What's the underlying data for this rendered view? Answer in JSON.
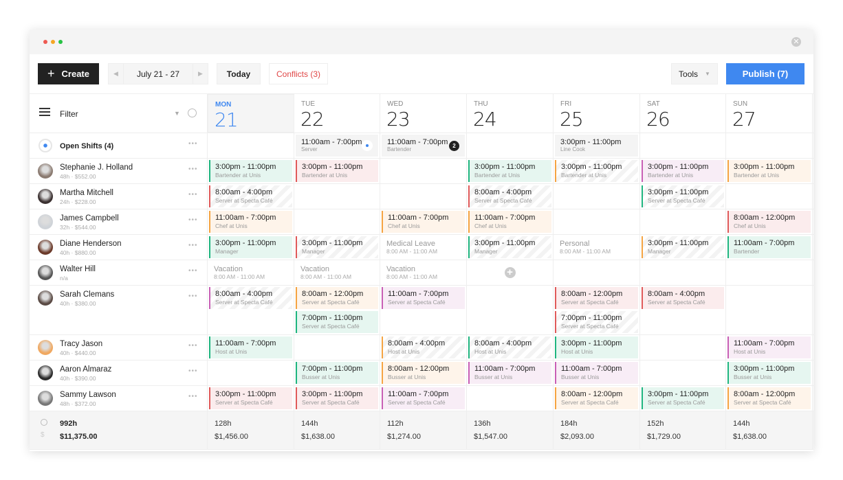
{
  "window": {
    "close_icon": "close-icon",
    "dots": [
      "#ee5a52",
      "#f5a623",
      "#27c245"
    ]
  },
  "toolbar": {
    "create_label": "Create",
    "date_range": "July 21 - 27",
    "today_label": "Today",
    "conflicts_label": "Conflicts (3)",
    "tools_label": "Tools",
    "publish_label": "Publish (7)"
  },
  "colors": {
    "accent": "#3f88f0",
    "conflict": "#e04646",
    "green": "#1fb57f",
    "red": "#e05a5a",
    "orange": "#f5a442",
    "pink": "#c85fb5"
  },
  "filter": {
    "label": "Filter"
  },
  "days": [
    {
      "name": "MON",
      "date": "21",
      "today": true
    },
    {
      "name": "TUE",
      "date": "22"
    },
    {
      "name": "WED",
      "date": "23"
    },
    {
      "name": "THU",
      "date": "24"
    },
    {
      "name": "FRI",
      "date": "25"
    },
    {
      "name": "SAT",
      "date": "26"
    },
    {
      "name": "SUN",
      "date": "27"
    }
  ],
  "open_shifts": {
    "label": "Open Shifts (4)",
    "days": [
      null,
      {
        "time": "11:00am - 7:00pm",
        "role": "Server",
        "marker": "dot"
      },
      {
        "time": "11:00am - 7:00pm",
        "role": "Bartender",
        "badge": "2"
      },
      null,
      {
        "time": "3:00pm - 11:00pm",
        "role": "Line Cook"
      },
      null,
      null
    ]
  },
  "employees": [
    {
      "name": "Stephanie J. Holland",
      "meta": "48h · $552.00",
      "days": [
        [
          {
            "time": "3:00pm - 11:00pm",
            "role": "Bartender at Unis",
            "color": "green"
          }
        ],
        [
          {
            "time": "3:00pm - 11:00pm",
            "role": "Bartender at Unis",
            "color": "red"
          }
        ],
        [],
        [
          {
            "time": "3:00pm - 11:00pm",
            "role": "Bartender at Unis",
            "color": "green"
          }
        ],
        [
          {
            "time": "3:00pm - 11:00pm",
            "role": "Bartender at Unis",
            "color": "orange",
            "striped": true
          }
        ],
        [
          {
            "time": "3:00pm - 11:00pm",
            "role": "Bartender at Unis",
            "color": "pink"
          }
        ],
        [
          {
            "time": "3:00pm - 11:00pm",
            "role": "Bartender at Unis",
            "color": "orange"
          }
        ]
      ]
    },
    {
      "name": "Martha Mitchell",
      "meta": "24h · $228.00",
      "days": [
        [
          {
            "time": "8:00am - 4:00pm",
            "role": "Server at Specta Café",
            "color": "red",
            "striped": true
          }
        ],
        [],
        [],
        [
          {
            "time": "8:00am - 4:00pm",
            "role": "Server at Specta Café",
            "color": "red",
            "striped": true
          }
        ],
        [],
        [
          {
            "time": "3:00pm - 11:00pm",
            "role": "Server at Specta Café",
            "color": "green",
            "striped": true
          }
        ],
        []
      ]
    },
    {
      "name": "James Campbell",
      "meta": "32h · $544.00",
      "days": [
        [
          {
            "time": "11:00am - 7:00pm",
            "role": "Chef at Unis",
            "color": "orange"
          }
        ],
        [],
        [
          {
            "time": "11:00am - 7:00pm",
            "role": "Chef at Unis",
            "color": "orange"
          }
        ],
        [
          {
            "time": "11:00am - 7:00pm",
            "role": "Chef at Unis",
            "color": "orange"
          }
        ],
        [],
        [],
        [
          {
            "time": "8:00am - 12:00pm",
            "role": "Chef at Unis",
            "color": "red"
          }
        ]
      ]
    },
    {
      "name": "Diane Henderson",
      "meta": "40h · $880.00",
      "days": [
        [
          {
            "time": "3:00pm - 11:00pm",
            "role": "Manager",
            "color": "green"
          }
        ],
        [
          {
            "time": "3:00pm - 11:00pm",
            "role": "Manager",
            "color": "red",
            "striped": true
          }
        ],
        [
          {
            "leave": "Medical Leave",
            "time": "8:00 AM - 11:00 AM"
          }
        ],
        [
          {
            "time": "3:00pm - 11:00pm",
            "role": "Manager",
            "color": "green",
            "striped": true
          }
        ],
        [
          {
            "leave": "Personal",
            "time": "8:00 AM - 11:00 AM"
          }
        ],
        [
          {
            "time": "3:00pm - 11:00pm",
            "role": "Manager",
            "color": "orange",
            "striped": true
          }
        ],
        [
          {
            "time": "11:00am - 7:00pm",
            "role": "Bartender",
            "color": "green"
          }
        ]
      ]
    },
    {
      "name": "Walter Hill",
      "meta": "n/a",
      "days": [
        [
          {
            "leave": "Vacation",
            "time": "8:00 AM - 11:00 AM"
          }
        ],
        [
          {
            "leave": "Vacation",
            "time": "8:00 AM - 11:00 AM"
          }
        ],
        [
          {
            "leave": "Vacation",
            "time": "8:00 AM - 11:00 AM"
          }
        ],
        [
          {
            "add": true
          }
        ],
        [],
        [],
        []
      ]
    },
    {
      "name": "Sarah Clemans",
      "meta": "40h · $380.00",
      "tall": true,
      "days": [
        [
          {
            "time": "8:00am - 4:00pm",
            "role": "Server at Specta Café",
            "color": "pink",
            "striped": true
          }
        ],
        [
          {
            "time": "8:00am - 12:00pm",
            "role": "Server at Specta Café",
            "color": "orange"
          },
          {
            "time": "7:00pm - 11:00pm",
            "role": "Server at Specta Café",
            "color": "green"
          }
        ],
        [
          {
            "time": "11:00am - 7:00pm",
            "role": "Server at Specta Café",
            "color": "pink"
          }
        ],
        [],
        [
          {
            "time": "8:00am - 12:00pm",
            "role": "Server at Specta Café",
            "color": "red"
          },
          {
            "time": "7:00pm - 11:00pm",
            "role": "Server at Specta Café",
            "color": "red",
            "striped": true
          }
        ],
        [
          {
            "time": "8:00am - 4:00pm",
            "role": "Server at Specta Café",
            "color": "red"
          }
        ],
        []
      ]
    },
    {
      "name": "Tracy Jason",
      "meta": "40h · $440.00",
      "days": [
        [
          {
            "time": "11:00am - 7:00pm",
            "role": "Host at Unis",
            "color": "green"
          }
        ],
        [],
        [
          {
            "time": "8:00am - 4:00pm",
            "role": "Host at Unis",
            "color": "orange",
            "striped": true
          }
        ],
        [
          {
            "time": "8:00am - 4:00pm",
            "role": "Host at Unis",
            "color": "green",
            "striped": true
          }
        ],
        [
          {
            "time": "3:00pm - 11:00pm",
            "role": "Host at Unis",
            "color": "green"
          }
        ],
        [],
        [
          {
            "time": "11:00am - 7:00pm",
            "role": "Host at Unis",
            "color": "pink"
          }
        ]
      ]
    },
    {
      "name": "Aaron Almaraz",
      "meta": "40h · $390.00",
      "days": [
        [],
        [
          {
            "time": "7:00pm - 11:00pm",
            "role": "Busser at Unis",
            "color": "green"
          }
        ],
        [
          {
            "time": "8:00am - 12:00pm",
            "role": "Busser at Unis",
            "color": "orange"
          }
        ],
        [
          {
            "time": "11:00am - 7:00pm",
            "role": "Busser at Unis",
            "color": "pink"
          }
        ],
        [
          {
            "time": "11:00am - 7:00pm",
            "role": "Busser at Unis",
            "color": "pink"
          }
        ],
        [],
        [
          {
            "time": "3:00pm - 11:00pm",
            "role": "Busser at Unis",
            "color": "green"
          }
        ]
      ]
    },
    {
      "name": "Sammy Lawson",
      "meta": "48h · $372.00",
      "days": [
        [
          {
            "time": "3:00pm - 11:00pm",
            "role": "Server at Specta Café",
            "color": "red"
          }
        ],
        [
          {
            "time": "3:00pm - 11:00pm",
            "role": "Server at Specta Café",
            "color": "red"
          }
        ],
        [
          {
            "time": "11:00am - 7:00pm",
            "role": "Server at Specta Café",
            "color": "pink"
          }
        ],
        [],
        [
          {
            "time": "8:00am - 12:00pm",
            "role": "Server at Specta Café",
            "color": "orange"
          }
        ],
        [
          {
            "time": "3:00pm - 11:00pm",
            "role": "Server at Specta Café",
            "color": "green"
          }
        ],
        [
          {
            "time": "8:00am - 12:00pm",
            "role": "Server at Specta Café",
            "color": "orange"
          }
        ]
      ]
    }
  ],
  "totals": {
    "hours": "992h",
    "cost": "$11,375.00",
    "days": [
      {
        "hours": "128h",
        "cost": "$1,456.00"
      },
      {
        "hours": "144h",
        "cost": "$1,638.00"
      },
      {
        "hours": "112h",
        "cost": "$1,274.00"
      },
      {
        "hours": "136h",
        "cost": "$1,547.00"
      },
      {
        "hours": "184h",
        "cost": "$2,093.00"
      },
      {
        "hours": "152h",
        "cost": "$1,729.00"
      },
      {
        "hours": "144h",
        "cost": "$1,638.00"
      }
    ]
  }
}
